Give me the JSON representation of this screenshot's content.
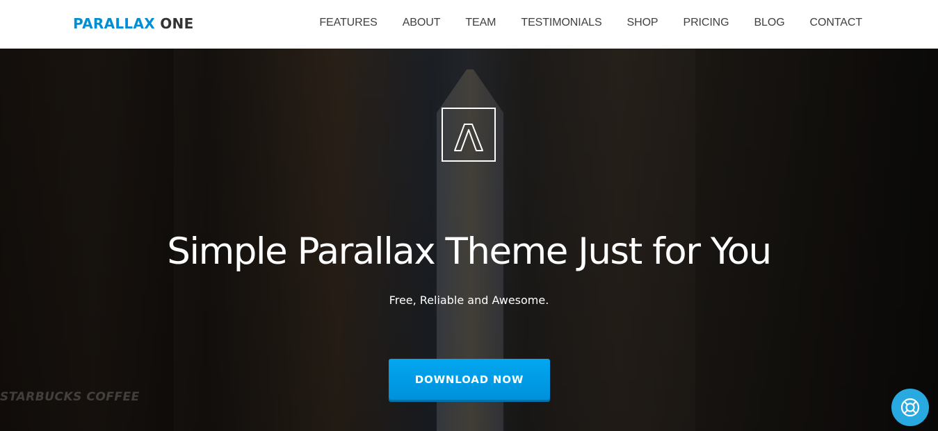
{
  "header": {
    "logo_part1": "PARALLAX",
    "logo_part2": " ONE",
    "nav": [
      {
        "label": "FEATURES"
      },
      {
        "label": "ABOUT"
      },
      {
        "label": "TEAM"
      },
      {
        "label": "TESTIMONIALS"
      },
      {
        "label": "SHOP"
      },
      {
        "label": "PRICING"
      },
      {
        "label": "BLOG"
      },
      {
        "label": "CONTACT"
      }
    ]
  },
  "hero": {
    "logo_icon": "chevron-up-outline-icon",
    "title": "Simple Parallax Theme Just for You",
    "subtitle": "Free, Reliable and Awesome.",
    "cta_label": "DOWNLOAD NOW",
    "background_sign": "STARBUCKS COFFEE"
  },
  "widgets": {
    "help_icon": "lifebuoy-icon"
  },
  "colors": {
    "brand": "#008ed6",
    "cta": "#02a7f0",
    "help": "#28a9e0"
  }
}
